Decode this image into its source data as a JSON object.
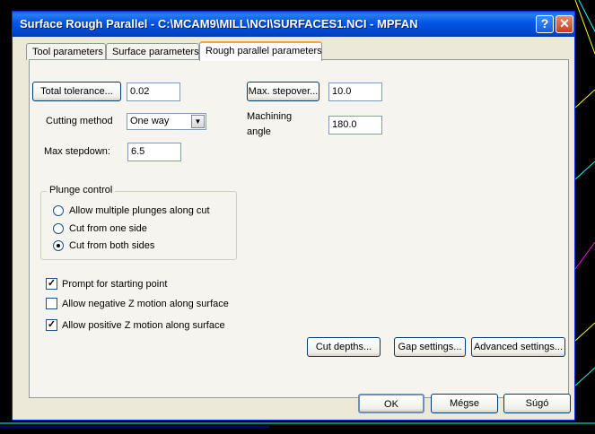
{
  "window": {
    "title": "Surface Rough Parallel - C:\\MCAM9\\MILL\\NCI\\SURFACES1.NCI - MPFAN",
    "help_glyph": "?",
    "close_glyph": "✕"
  },
  "tabs": [
    {
      "label": "Tool parameters"
    },
    {
      "label": "Surface parameters"
    },
    {
      "label": "Rough parallel parameters"
    }
  ],
  "fields": {
    "total_tolerance_button": "Total tolerance...",
    "total_tolerance_value": "0.02",
    "cutting_method_label": "Cutting method",
    "cutting_method_value": "One way",
    "max_stepdown_label": "Max stepdown:",
    "max_stepdown_value": "6.5",
    "max_stepover_button": "Max. stepover...",
    "max_stepover_value": "10.0",
    "machining_angle_label_line1": "Machining",
    "machining_angle_label_line2": "angle",
    "machining_angle_value": "180.0"
  },
  "plunge_control": {
    "legend": "Plunge control",
    "options": [
      {
        "label": "Allow multiple plunges along cut",
        "selected": false
      },
      {
        "label": "Cut from one side",
        "selected": false
      },
      {
        "label": "Cut from both sides",
        "selected": true
      }
    ]
  },
  "checkboxes": [
    {
      "label": "Prompt for starting point",
      "checked": true
    },
    {
      "label": "Allow negative Z motion along surface",
      "checked": false
    },
    {
      "label": "Allow positive Z motion along surface",
      "checked": true
    }
  ],
  "buttons": {
    "cut_depths": "Cut depths...",
    "gap_settings": "Gap settings...",
    "advanced_settings": "Advanced settings..."
  },
  "footer": {
    "ok": "OK",
    "cancel": "Mégse",
    "help": "Súgó"
  },
  "check_glyph": "✓"
}
